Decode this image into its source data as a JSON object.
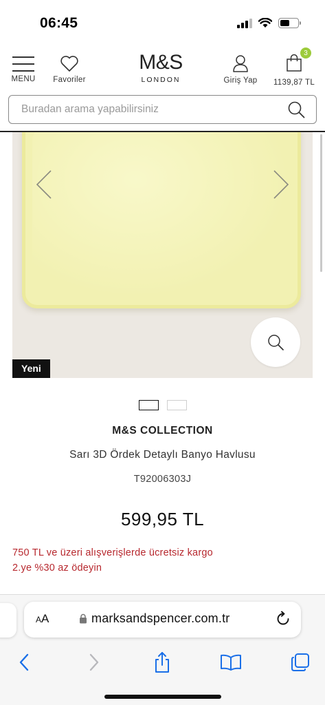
{
  "status_bar": {
    "time": "06:45"
  },
  "header": {
    "menu_label": "MENU",
    "favorites_label": "Favoriler",
    "logo_main": "M&S",
    "logo_sub": "LONDON",
    "login_label": "Giriş Yap",
    "basket_total": "1139,87 TL",
    "basket_count": "3"
  },
  "search": {
    "placeholder": "Buradan arama yapabilirsiniz"
  },
  "product": {
    "badge": "Yeni",
    "brand": "M&S COLLECTION",
    "name": "Sarı 3D Ördek Detaylı Banyo Havlusu",
    "sku": "T92006303J",
    "price": "599,95 TL",
    "promo_1": "750 TL ve üzeri alışverişlerde ücretsiz kargo",
    "promo_2": "2.ye %30 az ödeyin",
    "image_count": 2,
    "active_image": 1
  },
  "browser": {
    "aa_small": "A",
    "aa_large": "A",
    "url": "marksandspencer.com.tr"
  },
  "icons": {
    "favorites": "heart-icon",
    "login": "user-icon",
    "basket": "shopping-bag-icon",
    "search": "search-icon",
    "zoom": "zoom-icon",
    "lock": "lock-icon",
    "reload": "reload-icon",
    "back": "back-arrow-icon",
    "forward": "forward-arrow-icon",
    "share": "share-icon",
    "bookmarks": "book-icon",
    "tabs": "tabs-icon"
  },
  "colors": {
    "promo_red": "#b7282e",
    "badge_green": "#9ccb3b",
    "safari_blue": "#1a6fe8"
  }
}
